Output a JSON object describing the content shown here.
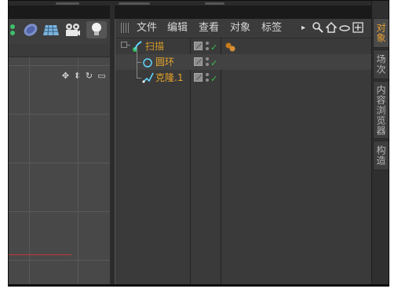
{
  "toolbar": {
    "icons": [
      "spline-pen-icon",
      "deformer-icon",
      "floor-grid-icon",
      "camera-icon",
      "light-bulb-icon"
    ]
  },
  "viewport": {
    "nav_icons": [
      "move-view-icon",
      "zoom-view-icon",
      "rotate-view-icon",
      "maximize-view-icon"
    ],
    "nav_glyphs": [
      "✥",
      "⬍",
      "↻",
      "▭"
    ]
  },
  "menubar": {
    "items": [
      "文件",
      "编辑",
      "查看",
      "对象",
      "标签"
    ],
    "right_icons": [
      "expand-arrow-icon",
      "search-icon",
      "home-icon",
      "link-icon",
      "new-window-icon"
    ],
    "right_glyphs": [
      "▸",
      "🔍",
      "⌂",
      "⬭",
      "⊞"
    ]
  },
  "objects": [
    {
      "name": "扫描",
      "icon": "sweep-icon",
      "color": "#d59a2b",
      "level": 0
    },
    {
      "name": "圆环",
      "icon": "circle-spline-icon",
      "color": "#e6a42a",
      "level": 1
    },
    {
      "name": "克隆.1",
      "icon": "spline-icon",
      "color": "#e6a42a",
      "level": 1
    }
  ],
  "tag_icon": "material-tag-icon",
  "side_tabs": [
    {
      "label": "对象",
      "active": true
    },
    {
      "label": "场次",
      "active": false
    },
    {
      "label": "内容浏览器",
      "active": false
    },
    {
      "label": "构造",
      "active": false
    }
  ]
}
